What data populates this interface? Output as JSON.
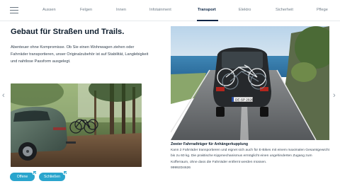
{
  "nav": {
    "menu_icon": "hamburger-menu-icon",
    "tabs": [
      {
        "label": "Aussen",
        "active": false
      },
      {
        "label": "Felgen",
        "active": false
      },
      {
        "label": "Innen",
        "active": false
      },
      {
        "label": "Infotainment",
        "active": false
      },
      {
        "label": "Transport",
        "active": true
      },
      {
        "label": "Elektro",
        "active": false
      },
      {
        "label": "Sicherheit",
        "active": false
      },
      {
        "label": "Pflege",
        "active": false
      }
    ]
  },
  "main": {
    "headline": "Gebaut für Straßen und Trails.",
    "intro": "Abenteuer ohne Kompromisse. Ob Sie einen Wohnwagen ziehen oder Fahrräder transportieren, unser Originalzubehör ist auf Stabilität, Langlebigkeit und nahtlose Passform ausgelegt.",
    "buttons": [
      {
        "label": "Offene"
      },
      {
        "label": "Schließen"
      }
    ]
  },
  "product": {
    "title": "Zweier Fahrradträger für Anhängerkupplung",
    "description": "Kann 2 Fahrräder transportieren und eignet sich auch für E-Bikes mit einem maximalen Gesamtgewicht bis zu 60 kg. Die praktische Kippmechanismus ermöglicht einen ungehinderten Zugang zum Kofferraum, ohne dass die Fahrräder entfernt werden müssen.",
    "part_number": "99992D4626",
    "plate_text": "DE·SP 2026"
  },
  "arrows": {
    "prev": "‹",
    "next": "›"
  },
  "colors": {
    "accent": "#2aa5cd",
    "nav_active": "#0b2545"
  }
}
